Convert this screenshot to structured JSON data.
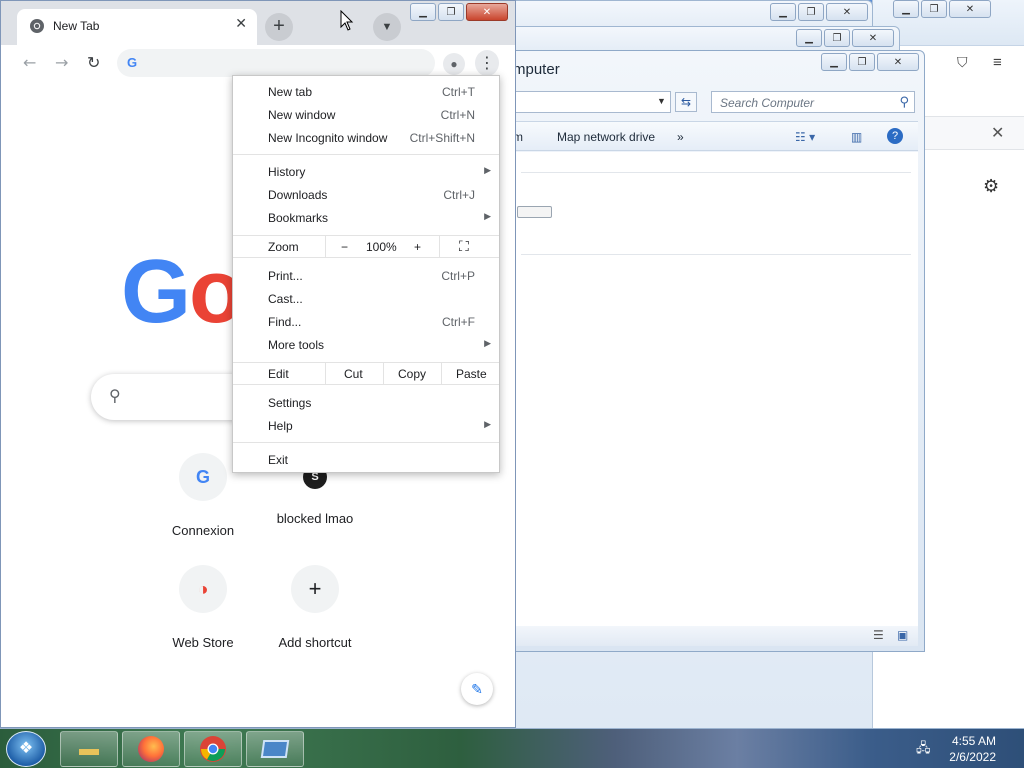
{
  "chrome": {
    "tab_title": "New Tab",
    "omnibox_value": "",
    "logo_text": [
      "G",
      "o"
    ],
    "shortcuts": [
      {
        "label": "Connexion",
        "glyph": "G"
      },
      {
        "label": "blocked lmao",
        "glyph": "S"
      },
      {
        "label": "Web Store",
        "glyph": "◑"
      },
      {
        "label": "Add shortcut",
        "glyph": "+"
      }
    ]
  },
  "menu": {
    "items_top": [
      {
        "label": "New tab",
        "shortcut": "Ctrl+T"
      },
      {
        "label": "New window",
        "shortcut": "Ctrl+N"
      },
      {
        "label": "New Incognito window",
        "shortcut": "Ctrl+Shift+N"
      }
    ],
    "items_history": [
      {
        "label": "History",
        "shortcut": ""
      },
      {
        "label": "Downloads",
        "shortcut": "Ctrl+J"
      },
      {
        "label": "Bookmarks",
        "shortcut": ""
      }
    ],
    "zoom": {
      "label": "Zoom",
      "minus": "−",
      "value": "100%",
      "plus": "+"
    },
    "items_print": [
      {
        "label": "Print...",
        "shortcut": "Ctrl+P"
      },
      {
        "label": "Cast...",
        "shortcut": ""
      },
      {
        "label": "Find...",
        "shortcut": "Ctrl+F"
      },
      {
        "label": "More tools",
        "shortcut": ""
      }
    ],
    "edit": {
      "label": "Edit",
      "cut": "Cut",
      "copy": "Copy",
      "paste": "Paste"
    },
    "items_settings": [
      {
        "label": "Settings"
      },
      {
        "label": "Help"
      }
    ],
    "exit": "Exit"
  },
  "explorer": {
    "title_fragment_1": "ter",
    "title_fragment_2": "mputer",
    "search_placeholder": "Search Computer",
    "cmd_fragment": "m",
    "map_network_drive": "Map network drive",
    "more": "»"
  },
  "taskbar": {
    "time": "4:55 AM",
    "date": "2/6/2022"
  },
  "colors": {
    "google_blue": "#4285f4",
    "google_red": "#ea4335",
    "chrome_frame": "#dee1e6"
  }
}
